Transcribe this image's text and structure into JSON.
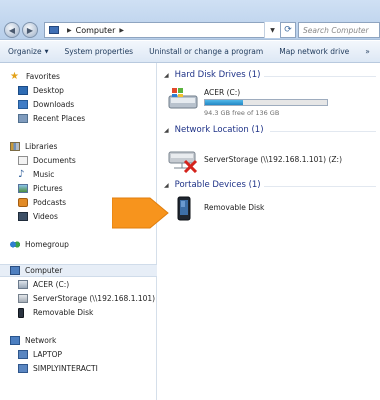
{
  "address_bar": {
    "crumbs": [
      "Computer"
    ],
    "search_placeholder": "Search Computer"
  },
  "toolbar": {
    "items": [
      {
        "label": "Organize",
        "has_caret": true
      },
      {
        "label": "System properties"
      },
      {
        "label": "Uninstall or change a program"
      },
      {
        "label": "Map network drive"
      },
      {
        "label": "»"
      }
    ]
  },
  "nav": {
    "favorites": {
      "label": "Favorites",
      "items": [
        "Desktop",
        "Downloads",
        "Recent Places"
      ]
    },
    "libraries": {
      "label": "Libraries",
      "items": [
        "Documents",
        "Music",
        "Pictures",
        "Podcasts",
        "Videos"
      ]
    },
    "homegroup": {
      "label": "Homegroup"
    },
    "computer": {
      "label": "Computer",
      "items": [
        "ACER (C:)",
        "ServerStorage (\\\\192.168.1.101) (Z:)",
        "Removable Disk"
      ]
    },
    "network": {
      "label": "Network",
      "items": [
        "LAPTOP",
        "SIMPLYINTERACTI"
      ]
    }
  },
  "content": {
    "hard_disk_drives": {
      "header": "Hard Disk Drives (1)",
      "drive": {
        "name": "ACER (C:)",
        "free_text": "94.3 GB free of 136 GB",
        "used_fraction": 0.31
      }
    },
    "network_location": {
      "header": "Network Location (1)",
      "drive": {
        "name": "ServerStorage (\\\\192.168.1.101) (Z:)"
      }
    },
    "portable_devices": {
      "header": "Portable Devices (1)",
      "device": {
        "name": "Removable Disk"
      }
    }
  },
  "colors": {
    "highlight_arrow": "#f7941d",
    "group_header": "#1e3287",
    "usage_bar": "#2a93cf"
  }
}
